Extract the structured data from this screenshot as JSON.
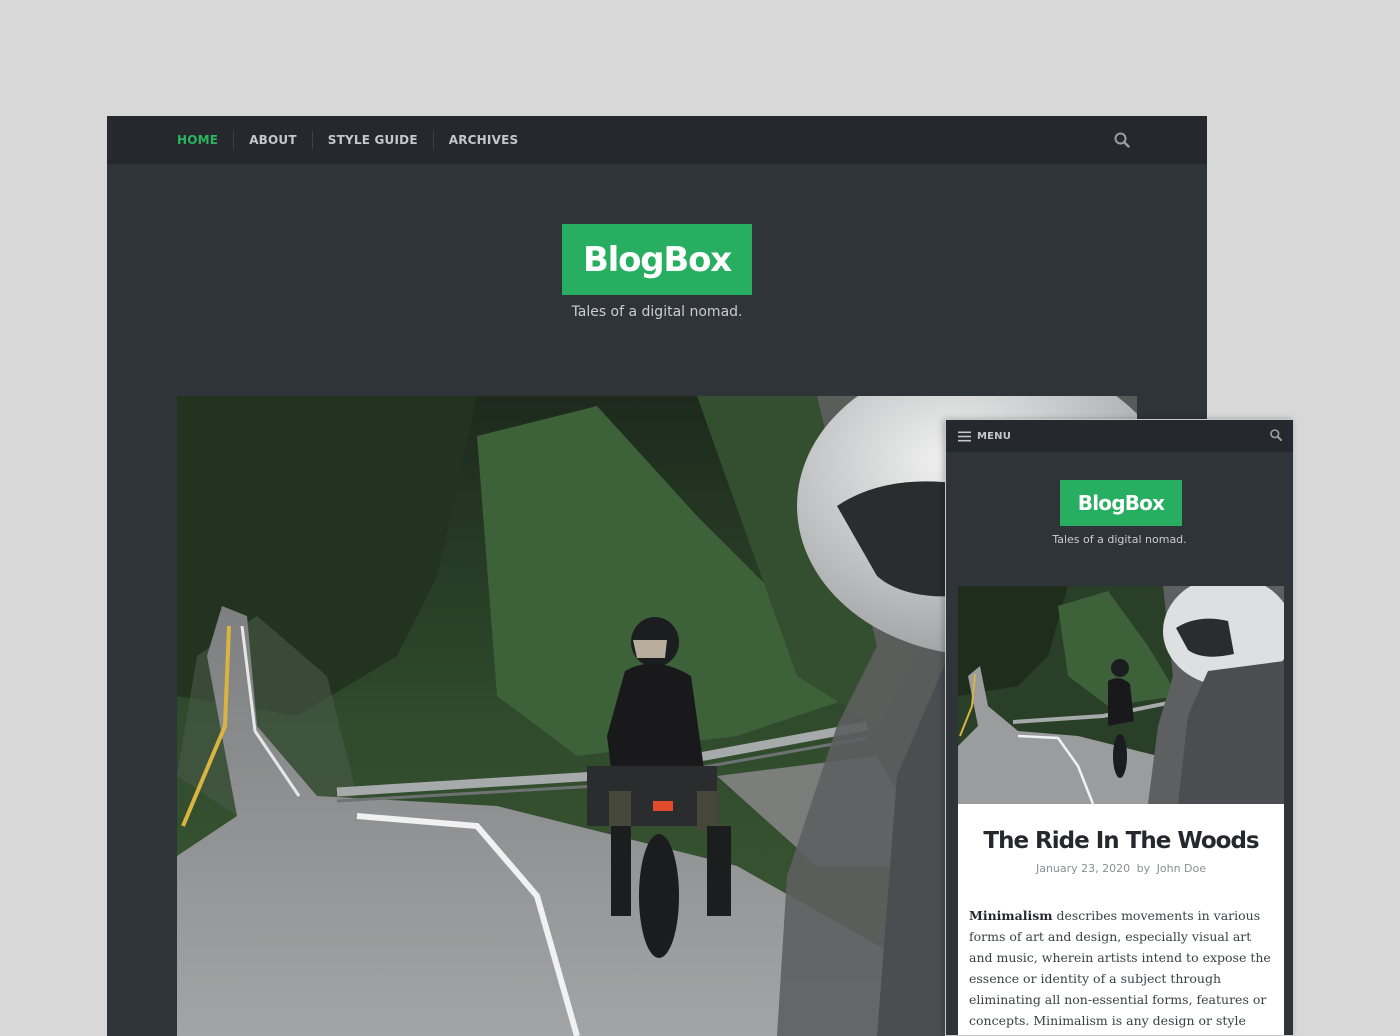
{
  "desktop": {
    "nav": {
      "items": [
        {
          "label": "HOME",
          "active": true
        },
        {
          "label": "ABOUT",
          "active": false
        },
        {
          "label": "STYLE GUIDE",
          "active": false
        },
        {
          "label": "ARCHIVES",
          "active": false
        }
      ],
      "search_icon": "search-icon"
    },
    "logo": "BlogBox",
    "tagline": "Tales of a digital nomad."
  },
  "mobile": {
    "nav": {
      "menu_icon": "hamburger-icon",
      "menu_label": "MENU",
      "search_icon": "search-icon"
    },
    "logo": "BlogBox",
    "tagline": "Tales of a digital nomad.",
    "post": {
      "title": "The Ride In The Woods",
      "date": "January 23, 2020",
      "by": "by",
      "author": "John Doe",
      "excerpt_bold": "Minimalism",
      "excerpt_rest": " describes movements in various forms of art and design, especially visual art and music, wherein artists intend to expose the essence or identity of a subject through eliminating all non-essential forms, features or concepts. Minimalism is any design or style wherein the simplest and fewest"
    }
  },
  "colors": {
    "accent": "#27ae60",
    "nav_bg": "#25292d",
    "page_bg": "#2f3439",
    "backdrop": "#d8d8d8"
  }
}
